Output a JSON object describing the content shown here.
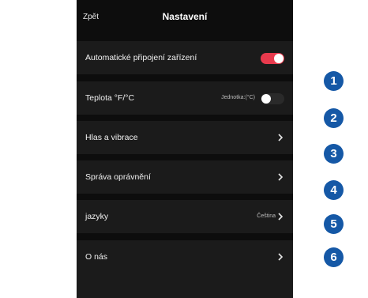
{
  "header": {
    "back_label": "Zpět",
    "title": "Nastavení"
  },
  "settings": {
    "auto_connect": {
      "label": "Automatické připojení zařízení",
      "toggle_on": true,
      "toggle_color": "#e83a4d"
    },
    "temperature": {
      "label": "Teplota °F/°C",
      "value": "Jednotka:(°C)",
      "toggle_on": false,
      "toggle_color": "#2a2a2a"
    },
    "sound_vibration": {
      "label": "Hlas a vibrace",
      "chevron_icon": "chevron-right-icon"
    },
    "permissions": {
      "label": "Správa oprávnění",
      "chevron_icon": "chevron-right-icon"
    },
    "languages": {
      "label": "jazyky",
      "value": "Čeština",
      "chevron_icon": "chevron-right-icon"
    },
    "about": {
      "label": "O nás",
      "chevron_icon": "chevron-right-icon"
    }
  },
  "callouts": [
    "1",
    "2",
    "3",
    "4",
    "5",
    "6"
  ],
  "colors": {
    "background": "#0d0d0d",
    "row": "#1b1b1b",
    "callout": "#1558a6"
  }
}
